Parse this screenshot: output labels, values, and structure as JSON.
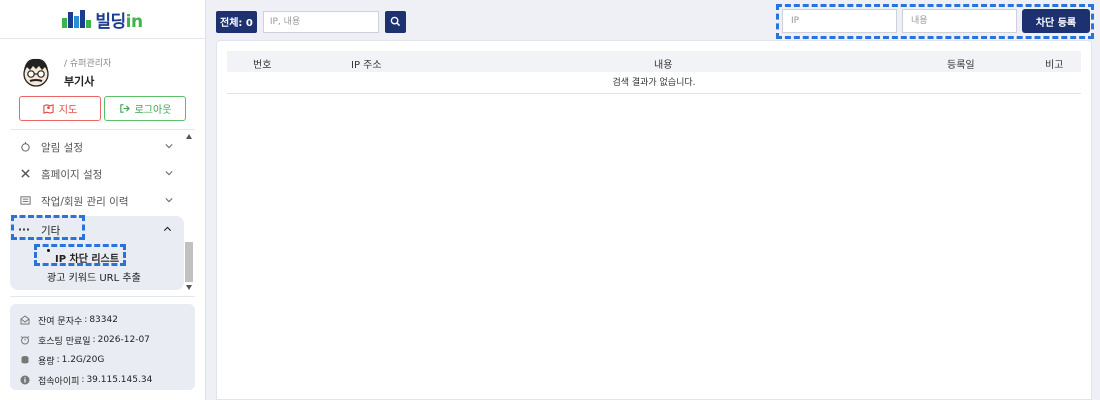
{
  "app": {
    "logo_text": "빌딩",
    "logo_suffix": "in"
  },
  "profile": {
    "role": "/ 슈퍼관리자",
    "name": "부기사"
  },
  "buttons": {
    "map": "지도",
    "logout": "로그아웃"
  },
  "menu": {
    "items": [
      {
        "label": "알림 설정",
        "icon": "bell-icon"
      },
      {
        "label": "홈페이지 설정",
        "icon": "tools-icon"
      },
      {
        "label": "작업/회원 관리 이력",
        "icon": "list-icon"
      }
    ],
    "open_group": {
      "label": "기타",
      "icon": "more-icon",
      "sub_items": [
        "IP 차단 리스트",
        "광고 키워드 URL 추출"
      ]
    }
  },
  "info": {
    "rows": [
      {
        "label": "잔여 문자수",
        "value": "83342",
        "icon": "mail-icon"
      },
      {
        "label": "호스팅 만료일",
        "value": "2026-12-07",
        "icon": "alarm-icon"
      },
      {
        "label": "용량",
        "value": "1.2G/20G",
        "icon": "database-icon"
      },
      {
        "label": "접속아이피",
        "value": "39.115.145.34",
        "icon": "info-icon"
      }
    ]
  },
  "toolbar": {
    "total_label": "전체: 0",
    "search_placeholder": "IP, 내용"
  },
  "block_form": {
    "ip_placeholder": "IP",
    "content_placeholder": "내용",
    "submit_label": "차단 등록"
  },
  "table": {
    "columns": [
      "번호",
      "IP 주소",
      "내용",
      "등록일",
      "비고"
    ],
    "empty_message": "검색 결과가 없습니다."
  },
  "colors": {
    "brand_navy": "#1d3170",
    "accent_green": "#3cb44b",
    "highlight": "#2a73dd"
  }
}
